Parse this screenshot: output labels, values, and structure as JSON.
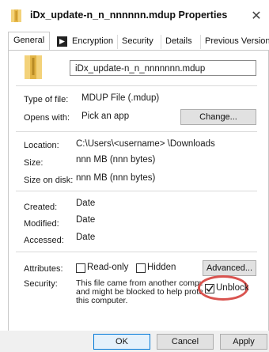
{
  "window": {
    "title": "iDx_update-n_n_nnnnnn.mdup Properties",
    "close_icon": "close-icon"
  },
  "tabs": [
    "General",
    "Encryption",
    "Security",
    "Details",
    "Previous Versions"
  ],
  "general": {
    "file_name": "iDx_update-n_n_nnnnnnn.mdup",
    "type_label": "Type of file:",
    "type_value": "MDUP File (.mdup)",
    "opens_label": "Opens with:",
    "opens_value": "Pick an app",
    "change_button": "Change...",
    "location_label": "Location:",
    "location_value": "C:\\Users\\<username>  \\Downloads",
    "size_label": "Size:",
    "size_value": "nnn MB (nnn bytes)",
    "size_disk_label": "Size on disk:",
    "size_disk_value": "nnn MB (nnn bytes)",
    "created_label": "Created:",
    "created_value": "Date",
    "modified_label": "Modified:",
    "modified_value": "Date",
    "accessed_label": "Accessed:",
    "accessed_value": "Date",
    "attributes_label": "Attributes:",
    "readonly_label": "Read-only",
    "hidden_label": "Hidden",
    "advanced_button": "Advanced...",
    "security_label": "Security:",
    "security_line1": "This file came from another compute",
    "security_line2": "and might be blocked to help protec",
    "security_line3": "this computer.",
    "unblock_label": "Unblock",
    "unblock_checked": true
  },
  "footer": {
    "ok": "OK",
    "cancel": "Cancel",
    "apply": "Apply"
  },
  "colors": {
    "accent_highlight": "#d9534f",
    "folder_icon": "#f0c24a"
  }
}
